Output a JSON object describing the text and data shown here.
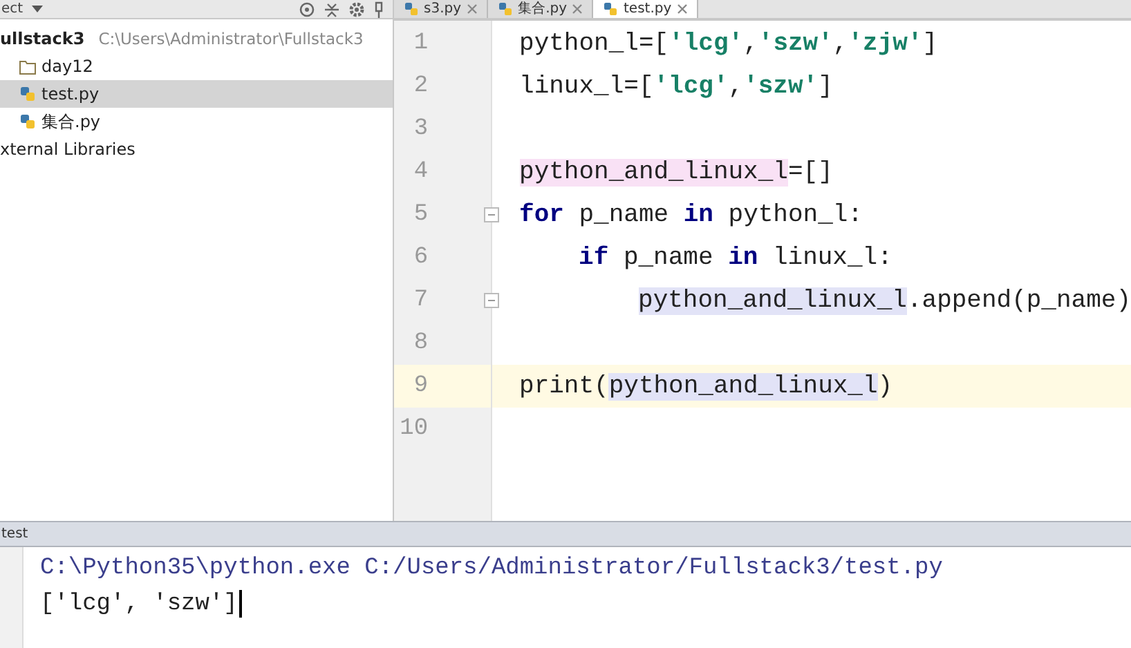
{
  "project_panel": {
    "selector": "ect",
    "tree": [
      {
        "name": "ullstack3",
        "path": "C:\\Users\\Administrator\\Fullstack3",
        "kind": "project",
        "selected": false,
        "children": [
          {
            "name": "day12",
            "kind": "folder",
            "selected": false
          },
          {
            "name": "test.py",
            "kind": "python",
            "selected": true
          },
          {
            "name": "集合.py",
            "kind": "python",
            "selected": false
          }
        ]
      },
      {
        "name": "xternal Libraries",
        "kind": "library",
        "selected": false
      }
    ]
  },
  "editor": {
    "tabs": [
      {
        "label": "s3.py",
        "selected": false
      },
      {
        "label": "集合.py",
        "selected": false
      },
      {
        "label": "test.py",
        "selected": true
      }
    ],
    "lines": [
      {
        "number": "1",
        "current": false,
        "fold": false,
        "tokens": [
          {
            "text": "python_l=[",
            "kind": "plain"
          },
          {
            "text": "'lcg'",
            "kind": "string"
          },
          {
            "text": ",",
            "kind": "plain"
          },
          {
            "text": "'szw'",
            "kind": "string"
          },
          {
            "text": ",",
            "kind": "plain"
          },
          {
            "text": "'zjw'",
            "kind": "string"
          },
          {
            "text": "]",
            "kind": "plain"
          }
        ]
      },
      {
        "number": "2",
        "current": false,
        "fold": false,
        "tokens": [
          {
            "text": "linux_l=[",
            "kind": "plain"
          },
          {
            "text": "'lcg'",
            "kind": "string"
          },
          {
            "text": ",",
            "kind": "plain"
          },
          {
            "text": "'szw'",
            "kind": "string"
          },
          {
            "text": "]",
            "kind": "plain"
          }
        ]
      },
      {
        "number": "3",
        "current": false,
        "fold": false
      },
      {
        "number": "4",
        "current": false,
        "fold": false,
        "tokens": [
          {
            "text": "python_and_linux_l",
            "kind": "write"
          },
          {
            "text": "=[]",
            "kind": "plain"
          }
        ]
      },
      {
        "number": "5",
        "current": false,
        "fold": true,
        "tokens": [
          {
            "text": "for",
            "kind": "keyword"
          },
          {
            "text": " p_name ",
            "kind": "plain"
          },
          {
            "text": "in",
            "kind": "keyword"
          },
          {
            "text": " python_l:",
            "kind": "plain"
          }
        ],
        "children": [
          {
            "number": "6",
            "current": false,
            "fold": false,
            "tokens": [
              {
                "text": "if",
                "kind": "keyword"
              },
              {
                "text": " p_name ",
                "kind": "plain"
              },
              {
                "text": "in",
                "kind": "keyword"
              },
              {
                "text": " linux_l:",
                "kind": "plain"
              }
            ],
            "children": [
              {
                "number": "7",
                "current": false,
                "fold": true,
                "tokens": [
                  {
                    "text": "python_and_linux_l",
                    "kind": "read"
                  },
                  {
                    "text": ".append(p_name)",
                    "kind": "plain"
                  }
                ]
              }
            ]
          }
        ]
      },
      {
        "number": "8",
        "current": false,
        "fold": false
      },
      {
        "number": "9",
        "current": true,
        "fold": false,
        "tokens": [
          {
            "text": "print(",
            "kind": "plain"
          },
          {
            "text": "python_and_linux_l",
            "kind": "read"
          },
          {
            "text": ")",
            "kind": "plain"
          }
        ]
      },
      {
        "number": "10",
        "current": false,
        "fold": false
      }
    ]
  },
  "run_panel": {
    "title": "test",
    "output": [
      {
        "text": "C:\\Python35\\python.exe C:/Users/Administrator/Fullstack3/test.py",
        "kind": "command"
      },
      {
        "text": "['lcg', 'szw']",
        "kind": "stdout"
      }
    ]
  }
}
